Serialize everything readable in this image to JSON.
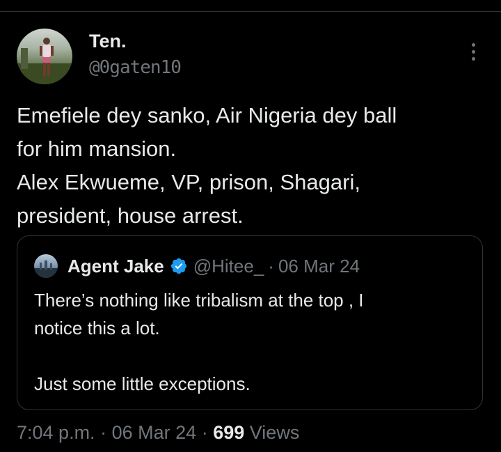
{
  "author": {
    "display_name": "Ten.",
    "handle": "@0gaten10"
  },
  "tweet": {
    "lines": [
      "Emefiele dey sanko, Air Nigeria dey ball",
      "for him mansion.",
      "Alex Ekwueme, VP, prison, Shagari,",
      "president, house arrest."
    ]
  },
  "quote": {
    "display_name": "Agent Jake",
    "handle": "@Hitee_",
    "separator": "·",
    "date": "06 Mar 24",
    "lines": [
      "There’s nothing like tribalism at the top , I",
      "notice this a lot.",
      "",
      "Just some little exceptions."
    ]
  },
  "meta": {
    "time": "7:04 p.m.",
    "separator": "·",
    "date": "06 Mar 24",
    "views_count": "699",
    "views_label": "Views"
  },
  "colors": {
    "background": "#000000",
    "text_primary": "#e7e9ea",
    "text_secondary": "#71767b",
    "border": "#2f3336",
    "verified": "#1d9bf0"
  },
  "icons": {
    "more": "more-vertical-icon",
    "verified": "verified-badge-icon"
  }
}
